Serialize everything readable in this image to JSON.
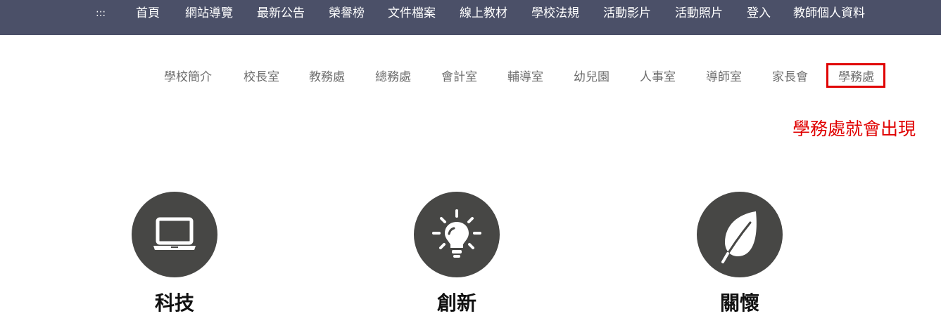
{
  "top_nav": {
    "menu_icon": "dots-grid-icon",
    "items": [
      "首頁",
      "網站導覽",
      "最新公告",
      "榮譽榜",
      "文件檔案",
      "線上教材",
      "學校法規",
      "活動影片",
      "活動照片",
      "登入",
      "教師個人資料"
    ]
  },
  "sub_nav": {
    "items": [
      "學校簡介",
      "校長室",
      "教務處",
      "總務處",
      "會計室",
      "輔導室",
      "幼兒園",
      "人事室",
      "導師室",
      "家長會",
      "學務處"
    ],
    "highlighted": "學務處"
  },
  "annotation": {
    "text": "學務處就會出現",
    "color": "#e00000"
  },
  "features": [
    {
      "icon": "laptop-icon",
      "title": "科技"
    },
    {
      "icon": "lightbulb-icon",
      "title": "創新"
    },
    {
      "icon": "leaf-icon",
      "title": "關懷"
    }
  ],
  "colors": {
    "nav_bar": "#4b5068",
    "icon_circle": "#474745",
    "sub_nav_text": "#6d6d6d"
  }
}
